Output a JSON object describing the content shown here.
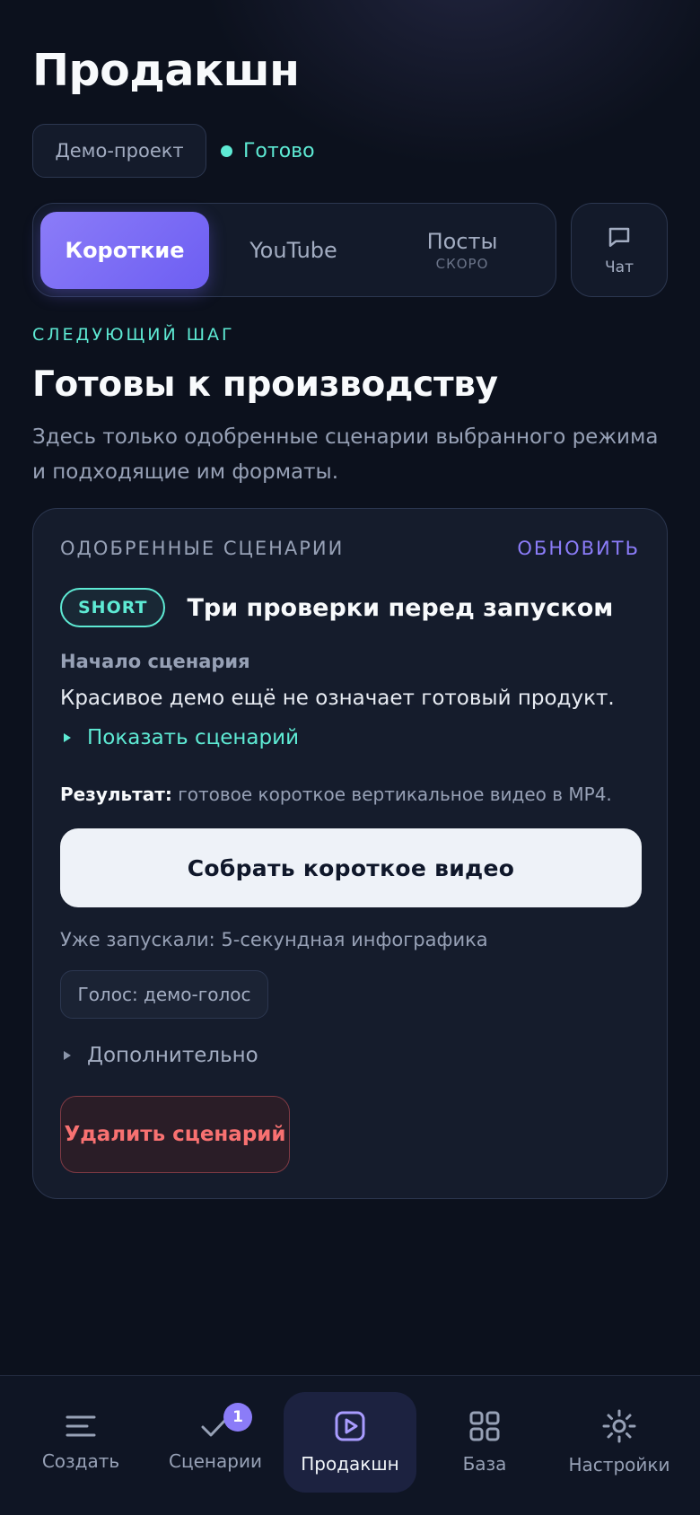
{
  "header": {
    "title": "Продакшн",
    "project": "Демо-проект",
    "status": "Готово"
  },
  "mode_tabs": [
    {
      "label": "Короткие",
      "active": true
    },
    {
      "label": "YouTube",
      "active": false
    },
    {
      "label": "Посты",
      "sub": "СКОРО",
      "active": false
    }
  ],
  "chat": {
    "label": "Чат",
    "icon": "chat-bubble-icon"
  },
  "section": {
    "eyebrow": "СЛЕДУЮЩИЙ ШАГ",
    "title": "Готовы к производству",
    "description": "Здесь только одобренные сценарии выбранного режима и подходящие им форматы."
  },
  "card": {
    "label": "ОДОБРЕННЫЕ СЦЕНАРИИ",
    "refresh": "ОБНОВИТЬ",
    "badge": "SHORT",
    "script_title": "Три проверки перед запуском",
    "start_label": "Начало сценария",
    "start_text": "Красивое демо ещё не означает готовый продукт.",
    "show_script": "Показать сценарий",
    "result_label": "Результат:",
    "result_text": "готовое короткое вертикальное видео в MP4.",
    "primary_button": "Собрать короткое видео",
    "already_run": "Уже запускали: 5-секундная инфографика",
    "voice_chip": "Голос: демо-голос",
    "more": "Дополнительно",
    "delete_button": "Удалить сценарий"
  },
  "nav": [
    {
      "label": "Создать",
      "icon": "lines-icon"
    },
    {
      "label": "Сценарии",
      "icon": "check-icon",
      "badge": "1"
    },
    {
      "label": "Продакшн",
      "icon": "play-square-icon",
      "active": true
    },
    {
      "label": "База",
      "icon": "grid-icon"
    },
    {
      "label": "Настройки",
      "icon": "sun-gear-icon"
    }
  ],
  "colors": {
    "accent": "#8b7cf8",
    "teal": "#5eead4",
    "danger": "#f87171",
    "background": "#0c111d"
  }
}
